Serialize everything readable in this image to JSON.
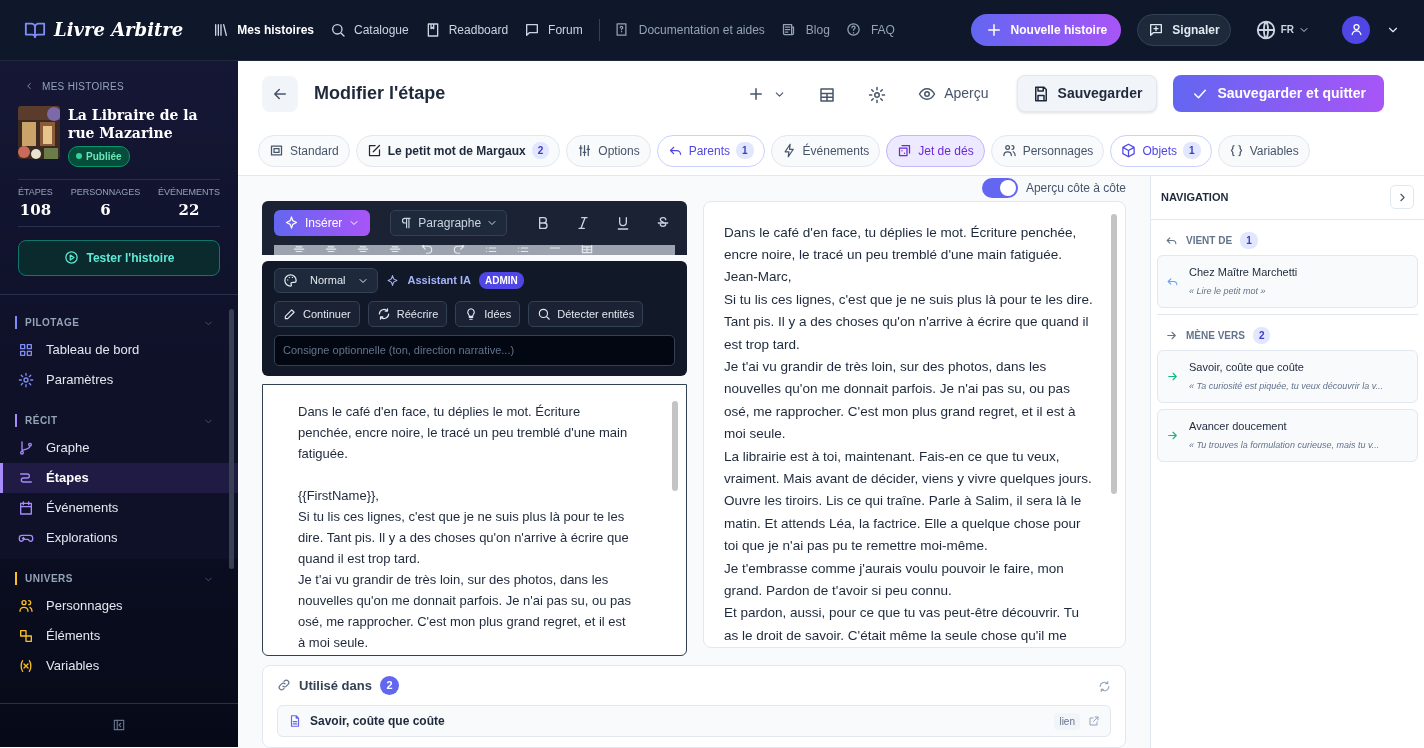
{
  "top_nav": {
    "logo": "Livre Arbitre",
    "links": [
      {
        "label": "Mes histoires",
        "selected": true
      },
      {
        "label": "Catalogue",
        "selected": false
      },
      {
        "label": "Readboard",
        "selected": false
      },
      {
        "label": "Forum",
        "selected": false
      }
    ],
    "help_links": [
      "Documentation et aides",
      "Blog",
      "FAQ"
    ],
    "new_button": "Nouvelle histoire",
    "report_button": "Signaler",
    "language": "FR"
  },
  "sidebar": {
    "back_link": "MES HISTOIRES",
    "story_title": "La Libraire de la rue Mazarine",
    "status": "Publiée",
    "stats": [
      {
        "label": "ÉTAPES",
        "value": "108"
      },
      {
        "label": "PERSONNAGES",
        "value": "6"
      },
      {
        "label": "ÉVÉNEMENTS",
        "value": "22"
      }
    ],
    "test_button": "Tester l'histoire",
    "sections": [
      {
        "title": "PILOTAGE",
        "color": "#818cf8",
        "items": [
          {
            "label": "Tableau de bord",
            "selected": false
          },
          {
            "label": "Paramètres",
            "selected": false
          }
        ]
      },
      {
        "title": "RÉCIT",
        "color": "#a78bfa",
        "items": [
          {
            "label": "Graphe",
            "selected": false
          },
          {
            "label": "Étapes",
            "selected": true
          },
          {
            "label": "Événements",
            "selected": false
          },
          {
            "label": "Explorations",
            "selected": false
          }
        ]
      },
      {
        "title": "UNIVERS",
        "color": "#fbbf24",
        "items": [
          {
            "label": "Personnages",
            "selected": false
          },
          {
            "label": "Éléments",
            "selected": false
          },
          {
            "label": "Variables",
            "selected": false
          }
        ]
      }
    ]
  },
  "header": {
    "title": "Modifier l'étape",
    "preview_button": "Aperçu",
    "save_button": "Sauvegarder",
    "save_quit_button": "Sauvegarder et quitter"
  },
  "tabs": [
    {
      "label": "Standard",
      "selected": false,
      "accent": false,
      "bold": false
    },
    {
      "label": "Le petit mot de Margaux",
      "count": "2",
      "selected": false,
      "accent": false,
      "bold": true
    },
    {
      "label": "Options",
      "selected": false,
      "accent": false,
      "bold": false
    },
    {
      "label": "Parents",
      "count": "1",
      "selected": false,
      "accent": true,
      "bold": false
    },
    {
      "label": "Événements",
      "selected": false,
      "accent": false,
      "bold": false
    },
    {
      "label": "Jet de dés",
      "selected": true,
      "accent": true,
      "bold": false
    },
    {
      "label": "Personnages",
      "selected": false,
      "accent": false,
      "bold": false
    },
    {
      "label": "Objets",
      "count": "1",
      "selected": false,
      "accent": true,
      "bold": false
    },
    {
      "label": "Variables",
      "selected": false,
      "accent": false,
      "bold": false
    }
  ],
  "side_by_side": {
    "label": "Aperçu côte à côte",
    "on": true
  },
  "editor": {
    "insert_button": "Insérer",
    "block_style": "Paragraphe",
    "ai": {
      "title": "Assistant IA",
      "badge": "ADMIN",
      "style": "Normal",
      "actions": [
        "Continuer",
        "Réécrire",
        "Idées",
        "Détecter entités"
      ],
      "placeholder": "Consigne optionnelle (ton, direction narrative...)"
    },
    "blocks": [
      [
        "Dans le café d'en face, tu déplies le mot. Écriture penchée, encre noire, le tracé un peu tremblé d'une main fatiguée."
      ],
      [
        "{{FirstName}},",
        "Si tu lis ces lignes, c'est que je ne suis plus là pour te les dire. Tant pis. Il y a des choses qu'on n'arrive à écrire que quand il est trop tard.",
        "Je t'ai vu grandir de très loin, sur des photos, dans les nouvelles qu'on me donnait parfois. Je n'ai pas su, ou pas osé, me rapprocher. C'est mon plus grand regret, et il est à moi seule."
      ]
    ]
  },
  "preview": {
    "paragraphs": [
      "Dans le café d'en face, tu déplies le mot. Écriture penchée, encre noire, le tracé un peu tremblé d'une main fatiguée.",
      "Jean-Marc,",
      "Si tu lis ces lignes, c'est que je ne suis plus là pour te les dire. Tant pis. Il y a des choses qu'on n'arrive à écrire que quand il est trop tard.",
      "Je t'ai vu grandir de très loin, sur des photos, dans les nouvelles qu'on me donnait parfois. Je n'ai pas su, ou pas osé, me rapprocher. C'est mon plus grand regret, et il est à moi seule.",
      "La librairie est à toi, maintenant. Fais-en ce que tu veux, vraiment. Mais avant de décider, viens y vivre quelques jours. Ouvre les tiroirs. Lis ce qui traîne. Parle à Salim, il sera là le matin. Et attends Léa, la factrice. Elle a quelque chose pour toi que je n'ai pas pu te remettre moi-même.",
      "Je t'embrasse comme j'aurais voulu pouvoir le faire, mon grand. Pardon de t'avoir si peu connu.",
      "Et pardon, aussi, pour ce que tu vas peut-être découvrir. Tu as le droit de savoir. C'était même la seule chose qu'il me"
    ]
  },
  "used_in": {
    "title": "Utilisé dans",
    "count": "2",
    "items": [
      {
        "label": "Savoir, coûte que coûte",
        "tag": "lien"
      }
    ]
  },
  "navigation": {
    "title": "NAVIGATION",
    "groups": [
      {
        "kind": "from",
        "title": "VIENT DE",
        "count": "1",
        "items": [
          {
            "title": "Chez Maître Marchetti",
            "quote": "« Lire le petit mot »"
          }
        ]
      },
      {
        "kind": "to",
        "title": "MÈNE VERS",
        "count": "2",
        "items": [
          {
            "title": "Savoir, coûte que coûte",
            "quote": "« Ta curiosité est piquée, tu veux découvrir la v..."
          },
          {
            "title": "Avancer doucement",
            "quote": "« Tu trouves la formulation curieuse, mais tu v..."
          }
        ]
      }
    ]
  }
}
